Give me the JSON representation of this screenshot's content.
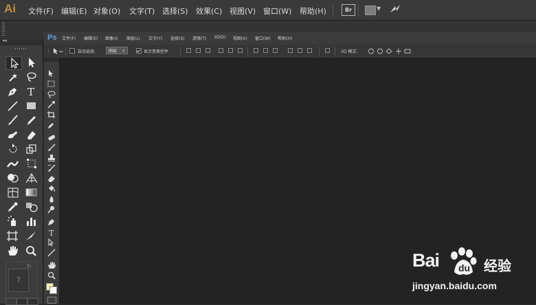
{
  "ai": {
    "logo": "Ai",
    "menu": [
      "文件(F)",
      "编辑(E)",
      "对象(O)",
      "文字(T)",
      "选择(S)",
      "效果(C)",
      "视图(V)",
      "窗口(W)",
      "帮助(H)"
    ],
    "bridge_label": "Br",
    "help_label": "?",
    "toolbox_collapse": "◂◂",
    "tools": [
      "selection-icon",
      "direct-selection-icon",
      "magic-wand-icon",
      "lasso-icon",
      "pen-icon",
      "type-icon",
      "line-segment-icon",
      "rectangle-icon",
      "paintbrush-icon",
      "pencil-icon",
      "blob-brush-icon",
      "eraser-icon",
      "rotate-icon",
      "scale-icon",
      "width-icon",
      "free-transform-icon",
      "shape-builder-icon",
      "perspective-grid-icon",
      "mesh-icon",
      "gradient-icon",
      "eyedropper-icon",
      "blend-icon",
      "symbol-sprayer-icon",
      "column-graph-icon",
      "artboard-icon",
      "slice-icon",
      "hand-icon",
      "zoom-icon"
    ]
  },
  "ps": {
    "logo": "Ps",
    "menu": [
      "文件(F)",
      "编辑(E)",
      "图像(I)",
      "图层(L)",
      "文字(Y)",
      "选择(S)",
      "滤镜(T)",
      "3D(D)",
      "视图(V)",
      "窗口(W)",
      "帮助(H)"
    ],
    "options": {
      "auto_select_label": "自动选择:",
      "auto_select_value": "图层",
      "show_transform_label": "显示变换控件",
      "mode_3d_label": "3D 模式:"
    }
  },
  "watermark": {
    "logo_text_left": "Bai",
    "logo_text_right": "经验",
    "url": "jingyan.baidu.com"
  },
  "colors": {
    "ai_accent": "#c78c3d",
    "ps_accent": "#5ea3e8",
    "fg_swatch": "#f3efb0",
    "bg_swatch": "#ffffff"
  }
}
